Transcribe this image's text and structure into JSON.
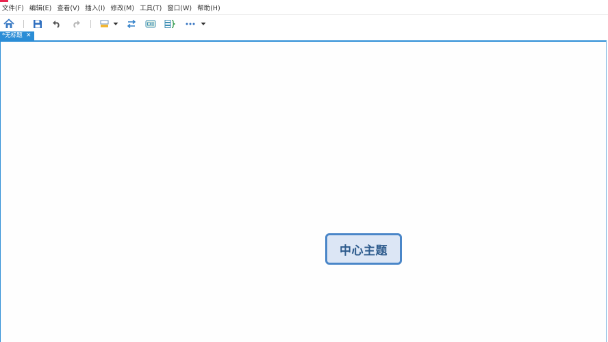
{
  "menubar": {
    "items": [
      {
        "label": "文件(F)"
      },
      {
        "label": "编辑(E)"
      },
      {
        "label": "查看(V)"
      },
      {
        "label": "插入(I)"
      },
      {
        "label": "修改(M)"
      },
      {
        "label": "工具(T)"
      },
      {
        "label": "窗口(W)"
      },
      {
        "label": "帮助(H)"
      }
    ]
  },
  "toolbar": {
    "icons": [
      "home-icon",
      "save-icon",
      "undo-icon",
      "redo-icon",
      "topic-style-icon",
      "dropdown-arrow-icon",
      "relationship-icon",
      "boundary-icon",
      "summary-icon",
      "more-icon",
      "dropdown-arrow-icon"
    ]
  },
  "tab": {
    "label": "*无标题",
    "close": "✕"
  },
  "canvas": {
    "central_topic": "中心主题"
  },
  "colors": {
    "accent": "#2b8dd6",
    "topic_border": "#4a86c8",
    "topic_fill": "#dce6f5",
    "topic_text": "#2c5a8c",
    "app_icon": "#e8264f"
  }
}
